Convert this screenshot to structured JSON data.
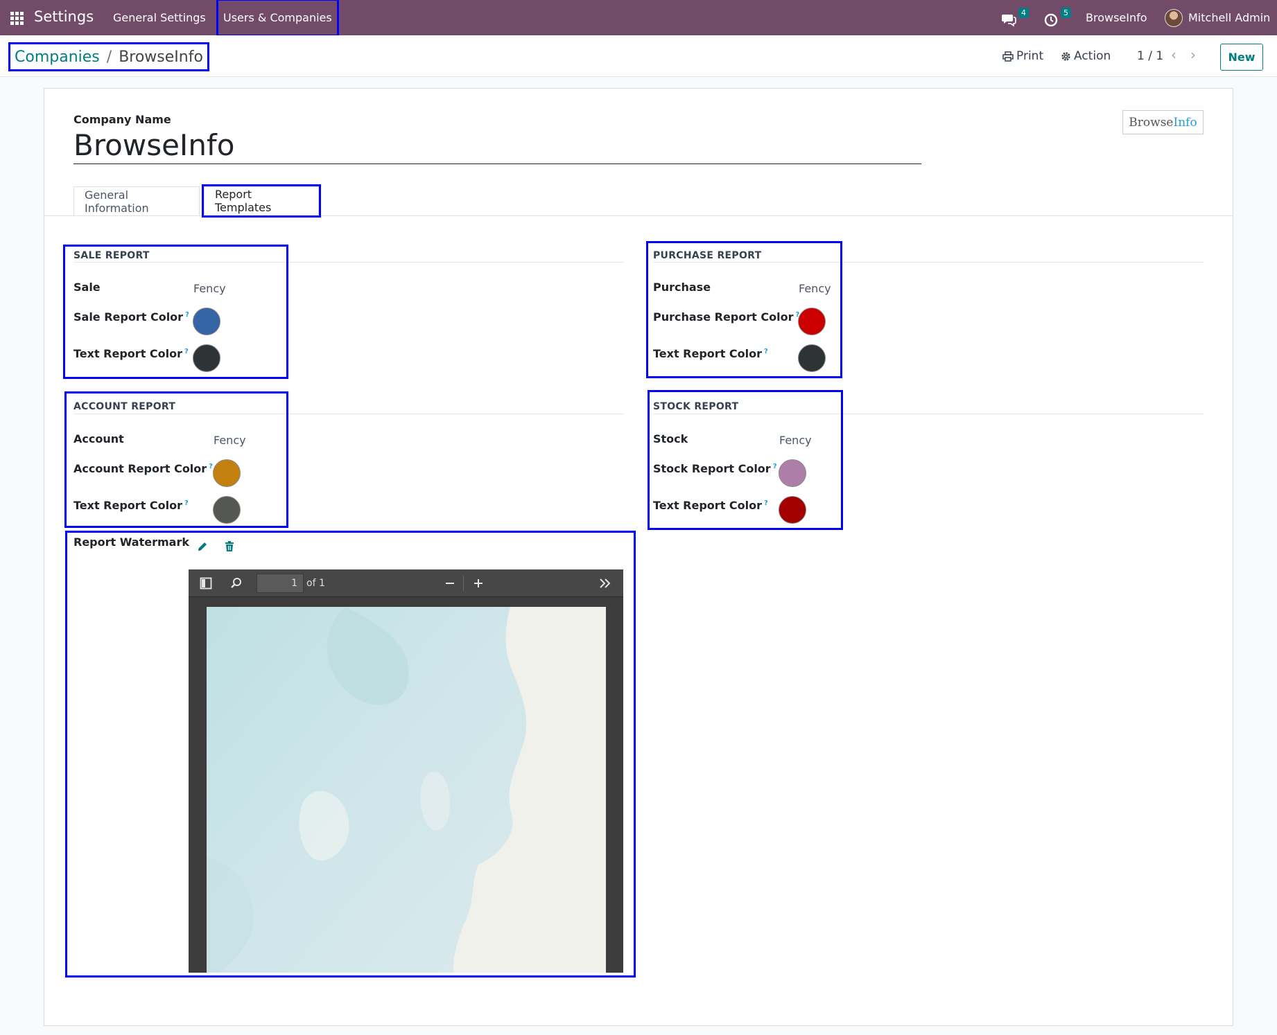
{
  "navbar": {
    "app_title": "Settings",
    "menu": [
      "General Settings",
      "Users & Companies"
    ],
    "messages_count": "4",
    "activities_count": "5",
    "company": "BrowseInfo",
    "user": "Mitchell Admin"
  },
  "control_panel": {
    "breadcrumb_parent": "Companies",
    "breadcrumb_separator": "/",
    "breadcrumb_current": "BrowseInfo",
    "print_label": "Print",
    "action_label": "Action",
    "pager": "1 / 1",
    "new_label": "New"
  },
  "form": {
    "company_name_label": "Company Name",
    "company_name": "BrowseInfo",
    "logo_text_main": "Browse",
    "logo_text_accent": "Info",
    "tabs": [
      "General Information",
      "Report Templates"
    ],
    "active_tab": "Report Templates"
  },
  "sale": {
    "title": "SALE REPORT",
    "field1_label": "Sale",
    "field1_value": "Fency",
    "color_label": "Sale Report Color",
    "color": "#3465a4",
    "text_color_label": "Text Report Color",
    "text_color": "#2e3436"
  },
  "purchase": {
    "title": "PURCHASE REPORT",
    "field1_label": "Purchase",
    "field1_value": "Fency",
    "color_label": "Purchase Report Color",
    "color": "#cc0000",
    "text_color_label": "Text Report Color",
    "text_color": "#2e3436"
  },
  "account": {
    "title": "ACCOUNT REPORT",
    "field1_label": "Account",
    "field1_value": "Fency",
    "color_label": "Account Report Color",
    "color": "#c4800f",
    "text_color_label": "Text Report Color",
    "text_color": "#555753"
  },
  "stock": {
    "title": "STOCK REPORT",
    "field1_label": "Stock",
    "field1_value": "Fency",
    "color_label": "Stock Report Color",
    "color": "#ad7fa8",
    "text_color_label": "Text Report Color",
    "text_color": "#a40000"
  },
  "watermark": {
    "label": "Report Watermark",
    "pdf_page_number": "1",
    "pdf_page_total": "of 1"
  },
  "help_marker": "?",
  "colors": {
    "navbar": "#714b67",
    "accent": "#017e84",
    "highlight": "#0000ff"
  }
}
